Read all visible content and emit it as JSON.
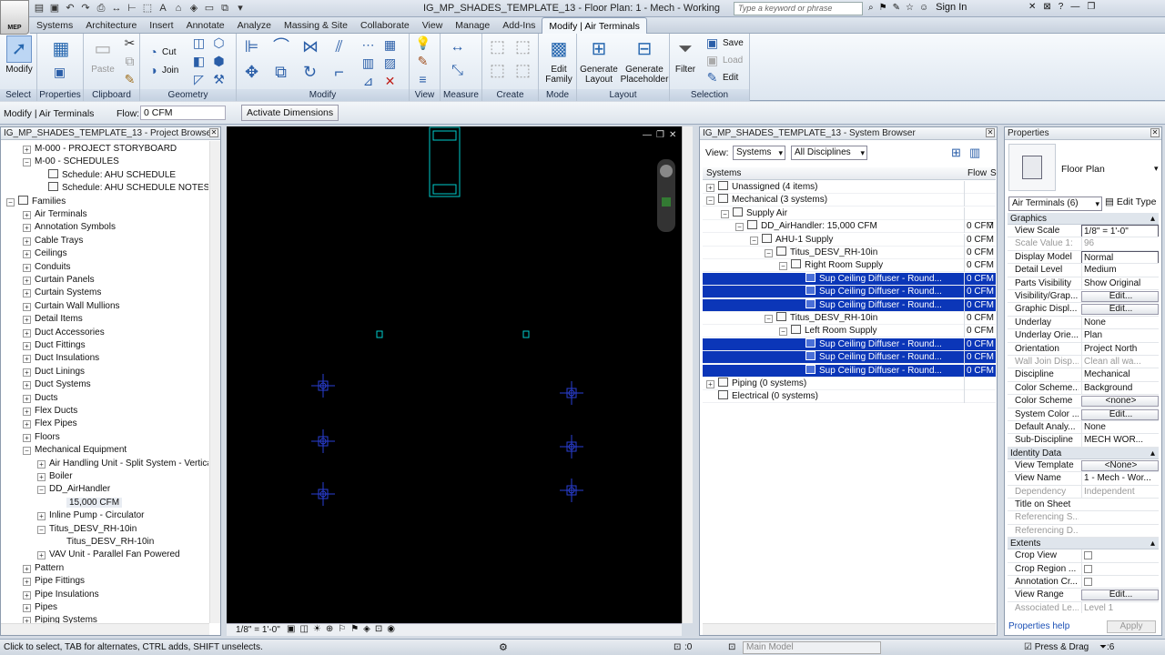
{
  "app": {
    "window_title": "IG_MP_SHADES_TEMPLATE_13 - Floor Plan: 1 - Mech - Working",
    "app_badge": "MEP",
    "search_placeholder": "Type a keyword or phrase",
    "sign_in": "Sign In"
  },
  "menu_tabs": [
    "Systems",
    "Architecture",
    "Insert",
    "Annotate",
    "Analyze",
    "Massing & Site",
    "Collaborate",
    "View",
    "Manage",
    "Add-Ins",
    "Modify | Air Terminals"
  ],
  "ribbon": {
    "modify": "Modify",
    "select": "Select",
    "properties": "Properties",
    "paste": "Paste",
    "clipboard": "Clipboard",
    "cut": "Cut",
    "join": "Join",
    "geometry": "Geometry",
    "modify_panel": "Modify",
    "view": "View",
    "measure": "Measure",
    "create": "Create",
    "edit_family": [
      "Edit",
      "Family"
    ],
    "mode": "Mode",
    "generate_layout": [
      "Generate",
      "Layout"
    ],
    "generate_placeholder": [
      "Generate",
      "Placeholder"
    ],
    "layout": "Layout",
    "filter": "Filter",
    "save": "Save",
    "load": "Load",
    "edit": "Edit",
    "selection": "Selection"
  },
  "optionsbar": {
    "context": "Modify | Air Terminals",
    "flow_label": "Flow:",
    "flow_value": "0 CFM",
    "activate": "Activate Dimensions"
  },
  "project_browser": {
    "title": "IG_MP_SHADES_TEMPLATE_13 - Project Browser",
    "rows": [
      {
        "t": "M-000 - PROJECT STORYBOARD",
        "x": 40,
        "tg": "+"
      },
      {
        "t": "M-00 - SCHEDULES",
        "x": 40,
        "tg": "−"
      },
      {
        "t": "Schedule: AHU SCHEDULE",
        "x": 52,
        "ico": 1
      },
      {
        "t": "Schedule: AHU SCHEDULE NOTES",
        "x": 52,
        "ico": 1
      },
      {
        "t": "Families",
        "x": 22,
        "tg": "−",
        "ico": 1
      },
      {
        "t": "Air Terminals",
        "x": 40,
        "tg": "+"
      },
      {
        "t": "Annotation Symbols",
        "x": 40,
        "tg": "+"
      },
      {
        "t": "Cable Trays",
        "x": 40,
        "tg": "+"
      },
      {
        "t": "Ceilings",
        "x": 40,
        "tg": "+"
      },
      {
        "t": "Conduits",
        "x": 40,
        "tg": "+"
      },
      {
        "t": "Curtain Panels",
        "x": 40,
        "tg": "+"
      },
      {
        "t": "Curtain Systems",
        "x": 40,
        "tg": "+"
      },
      {
        "t": "Curtain Wall Mullions",
        "x": 40,
        "tg": "+"
      },
      {
        "t": "Detail Items",
        "x": 40,
        "tg": "+"
      },
      {
        "t": "Duct Accessories",
        "x": 40,
        "tg": "+"
      },
      {
        "t": "Duct Fittings",
        "x": 40,
        "tg": "+"
      },
      {
        "t": "Duct Insulations",
        "x": 40,
        "tg": "+"
      },
      {
        "t": "Duct Linings",
        "x": 40,
        "tg": "+"
      },
      {
        "t": "Duct Systems",
        "x": 40,
        "tg": "+"
      },
      {
        "t": "Ducts",
        "x": 40,
        "tg": "+"
      },
      {
        "t": "Flex Ducts",
        "x": 40,
        "tg": "+"
      },
      {
        "t": "Flex Pipes",
        "x": 40,
        "tg": "+"
      },
      {
        "t": "Floors",
        "x": 40,
        "tg": "+"
      },
      {
        "t": "Mechanical Equipment",
        "x": 40,
        "tg": "−"
      },
      {
        "t": "Air Handling Unit - Split System - Vertica",
        "x": 56,
        "tg": "+"
      },
      {
        "t": "Boiler",
        "x": 56,
        "tg": "+"
      },
      {
        "t": "DD_AirHandler",
        "x": 56,
        "tg": "−"
      },
      {
        "t": "15,000 CFM",
        "x": 72,
        "hl": 1
      },
      {
        "t": "Inline Pump - Circulator",
        "x": 56,
        "tg": "+"
      },
      {
        "t": "Titus_DESV_RH-10in",
        "x": 56,
        "tg": "−"
      },
      {
        "t": "Titus_DESV_RH-10in",
        "x": 72
      },
      {
        "t": "VAV Unit - Parallel Fan Powered",
        "x": 56,
        "tg": "+"
      },
      {
        "t": "Pattern",
        "x": 40,
        "tg": "+"
      },
      {
        "t": "Pipe Fittings",
        "x": 40,
        "tg": "+"
      },
      {
        "t": "Pipe Insulations",
        "x": 40,
        "tg": "+"
      },
      {
        "t": "Pipes",
        "x": 40,
        "tg": "+"
      },
      {
        "t": "Piping Systems",
        "x": 40,
        "tg": "+"
      }
    ]
  },
  "viewbar": {
    "scale": "1/8\" = 1'-0\""
  },
  "system_browser": {
    "title": "IG_MP_SHADES_TEMPLATE_13 - System Browser",
    "view_label": "View:",
    "view_value": "Systems",
    "disc_value": "All Disciplines",
    "col_systems": "Systems",
    "col_flow": "Flow",
    "col_s": "S",
    "rows": [
      {
        "t": "Unassigned (4 items)",
        "d": 0,
        "tg": "+",
        "f": ""
      },
      {
        "t": "Mechanical (3 systems)",
        "d": 0,
        "tg": "−",
        "f": ""
      },
      {
        "t": "Supply Air",
        "d": 1,
        "tg": "−",
        "f": ""
      },
      {
        "t": "DD_AirHandler: 15,000 CFM",
        "d": 2,
        "tg": "−",
        "f": "0 CFM",
        "x": "7"
      },
      {
        "t": "AHU-1 Supply",
        "d": 3,
        "tg": "−",
        "f": "0 CFM"
      },
      {
        "t": "Titus_DESV_RH-10in",
        "d": 4,
        "tg": "−",
        "f": "0 CFM"
      },
      {
        "t": "Right Room Supply",
        "d": 5,
        "tg": "−",
        "f": "0 CFM"
      },
      {
        "t": "Sup Ceiling Diffuser - Round...",
        "d": 6,
        "f": "0 CFM",
        "sel": 1
      },
      {
        "t": "Sup Ceiling Diffuser - Round...",
        "d": 6,
        "f": "0 CFM",
        "sel": 1
      },
      {
        "t": "Sup Ceiling Diffuser - Round...",
        "d": 6,
        "f": "0 CFM",
        "sel": 1
      },
      {
        "t": "Titus_DESV_RH-10in",
        "d": 4,
        "tg": "−",
        "f": "0 CFM"
      },
      {
        "t": "Left Room Supply",
        "d": 5,
        "tg": "−",
        "f": "0 CFM"
      },
      {
        "t": "Sup Ceiling Diffuser - Round...",
        "d": 6,
        "f": "0 CFM",
        "sel": 1
      },
      {
        "t": "Sup Ceiling Diffuser - Round...",
        "d": 6,
        "f": "0 CFM",
        "sel": 1
      },
      {
        "t": "Sup Ceiling Diffuser - Round...",
        "d": 6,
        "f": "0 CFM",
        "sel": 1
      },
      {
        "t": "Piping (0 systems)",
        "d": 0,
        "tg": "+",
        "f": ""
      },
      {
        "t": "Electrical (0 systems)",
        "d": 0,
        "f": ""
      }
    ]
  },
  "properties": {
    "title": "Properties",
    "type_name": "Floor Plan",
    "instance": "Air Terminals (6)",
    "edit_type": "Edit Type",
    "help": "Properties help",
    "apply": "Apply",
    "rows": [
      {
        "g": "Graphics"
      },
      {
        "k": "View Scale",
        "v": "1/8\" = 1'-0\"",
        "w": "drop"
      },
      {
        "k": "Scale Value    1:",
        "v": "96",
        "dim": 1
      },
      {
        "k": "Display Model",
        "v": "Normal",
        "w": "box"
      },
      {
        "k": "Detail Level",
        "v": "Medium"
      },
      {
        "k": "Parts Visibility",
        "v": "Show Original"
      },
      {
        "k": "Visibility/Grap...",
        "v": "Edit...",
        "w": "btn"
      },
      {
        "k": "Graphic Displ...",
        "v": "Edit...",
        "w": "btn"
      },
      {
        "k": "Underlay",
        "v": "None"
      },
      {
        "k": "Underlay Orie...",
        "v": "Plan"
      },
      {
        "k": "Orientation",
        "v": "Project North"
      },
      {
        "k": "Wall Join Disp...",
        "v": "Clean all wa...",
        "dim": 1
      },
      {
        "k": "Discipline",
        "v": "Mechanical"
      },
      {
        "k": "Color Scheme...",
        "v": "Background"
      },
      {
        "k": "Color Scheme",
        "v": "<none>",
        "w": "btn"
      },
      {
        "k": "System Color ...",
        "v": "Edit...",
        "w": "btn"
      },
      {
        "k": "Default Analy...",
        "v": "None"
      },
      {
        "k": "Sub-Discipline",
        "v": "MECH WOR..."
      },
      {
        "g": "Identity Data"
      },
      {
        "k": "View Template",
        "v": "<None>",
        "w": "btn"
      },
      {
        "k": "View Name",
        "v": "1 - Mech - Wor..."
      },
      {
        "k": "Dependency",
        "v": "Independent",
        "dim": 1
      },
      {
        "k": "Title on Sheet",
        "v": ""
      },
      {
        "k": "Referencing S...",
        "v": "",
        "dim": 1
      },
      {
        "k": "Referencing D...",
        "v": "",
        "dim": 1
      },
      {
        "g": "Extents"
      },
      {
        "k": "Crop View",
        "v": "",
        "w": "chk"
      },
      {
        "k": "Crop Region ...",
        "v": "",
        "w": "chk"
      },
      {
        "k": "Annotation Cr...",
        "v": "",
        "w": "chk"
      },
      {
        "k": "View Range",
        "v": "Edit...",
        "w": "btn"
      },
      {
        "k": "Associated Le...",
        "v": "Level 1",
        "dim": 1
      }
    ]
  },
  "status": {
    "message": "Click to select, TAB for alternates, CTRL adds, SHIFT unselects.",
    "zero": ":0",
    "model": "Main Model",
    "press_drag": "Press & Drag",
    "filter_count": ":6"
  },
  "colors": {
    "selection": "#0b36b8",
    "canvas": "#000000",
    "diffuser": "#2a3fd6",
    "cyan": "#00cccc"
  }
}
